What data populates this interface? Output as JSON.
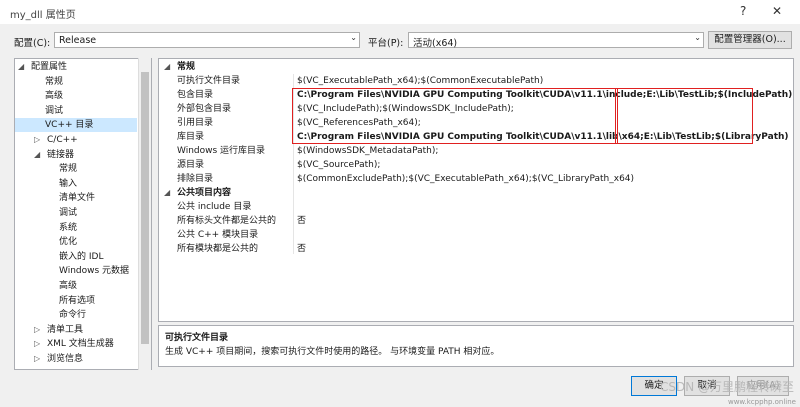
{
  "window": {
    "title": "my_dll 属性页",
    "help_label": "?",
    "close_label": "✕"
  },
  "config": {
    "config_label": "配置(C):",
    "config_value": "Release",
    "platform_label": "平台(P):",
    "platform_value": "活动(x64)",
    "manager_button": "配置管理器(O)..."
  },
  "tree": [
    {
      "label": "配置属性",
      "twisty": "◢",
      "level": 0
    },
    {
      "label": "常规",
      "level": 2
    },
    {
      "label": "高级",
      "level": 2
    },
    {
      "label": "调试",
      "level": 2
    },
    {
      "label": "VC++ 目录",
      "level": 2,
      "selected": true
    },
    {
      "label": "C/C++",
      "twisty": "▷",
      "level": 1
    },
    {
      "label": "链接器",
      "twisty": "◢",
      "level": 1
    },
    {
      "label": "常规",
      "level": 3
    },
    {
      "label": "输入",
      "level": 3
    },
    {
      "label": "清单文件",
      "level": 3
    },
    {
      "label": "调试",
      "level": 3
    },
    {
      "label": "系统",
      "level": 3
    },
    {
      "label": "优化",
      "level": 3
    },
    {
      "label": "嵌入的 IDL",
      "level": 3
    },
    {
      "label": "Windows 元数据",
      "level": 3
    },
    {
      "label": "高级",
      "level": 3
    },
    {
      "label": "所有选项",
      "level": 3
    },
    {
      "label": "命令行",
      "level": 3
    },
    {
      "label": "清单工具",
      "twisty": "▷",
      "level": 1
    },
    {
      "label": "XML 文档生成器",
      "twisty": "▷",
      "level": 1
    },
    {
      "label": "浏览信息",
      "twisty": "▷",
      "level": 1
    }
  ],
  "grid": {
    "cat_general": "常规",
    "cat_public": "公共项目内容",
    "rows": [
      {
        "name": "可执行文件目录",
        "value": "$(VC_ExecutablePath_x64);$(CommonExecutablePath)"
      },
      {
        "name": "包含目录",
        "value": "C:\\Program Files\\NVIDIA GPU Computing Toolkit\\CUDA\\v11.1\\include;E:\\Lib\\TestLib;$(IncludePath)"
      },
      {
        "name": "外部包含目录",
        "value": "$(VC_IncludePath);$(WindowsSDK_IncludePath);"
      },
      {
        "name": "引用目录",
        "value": "$(VC_ReferencesPath_x64);"
      },
      {
        "name": "库目录",
        "value": "C:\\Program Files\\NVIDIA GPU Computing Toolkit\\CUDA\\v11.1\\lib\\x64;E:\\Lib\\TestLib;$(LibraryPath)"
      },
      {
        "name": "Windows 运行库目录",
        "value": "$(WindowsSDK_MetadataPath);"
      },
      {
        "name": "源目录",
        "value": "$(VC_SourcePath);"
      },
      {
        "name": "排除目录",
        "value": "$(CommonExcludePath);$(VC_ExecutablePath_x64);$(VC_LibraryPath_x64)"
      }
    ],
    "public_rows": [
      {
        "name": "公共 include 目录",
        "value": ""
      },
      {
        "name": "所有标头文件都是公共的",
        "value": "否"
      },
      {
        "name": "公共 C++ 模块目录",
        "value": ""
      },
      {
        "name": "所有模块都是公共的",
        "value": "否"
      }
    ]
  },
  "description": {
    "title": "可执行文件目录",
    "text": "生成 VC++ 项目期间，搜索可执行文件时使用的路径。 与环境变量 PATH 相对应。"
  },
  "buttons": {
    "ok": "确定",
    "cancel": "取消",
    "apply": "应用(A)"
  },
  "watermark": "CSDN @万里鹏程转瞬至",
  "watermark2": "www.kcpphp.online",
  "colors": {
    "selection": "#cce8ff",
    "highlight_box": "#e02020"
  }
}
